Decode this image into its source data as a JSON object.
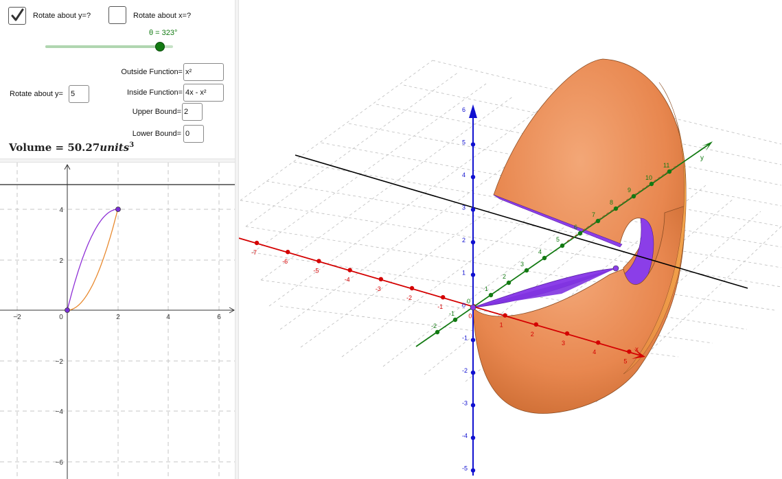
{
  "controls": {
    "rotate_y_checkbox": {
      "label": "Rotate about y=?",
      "checked": true
    },
    "rotate_x_checkbox": {
      "label": "Rotate about x=?",
      "checked": false
    },
    "theta_slider": {
      "label": "θ = 323°",
      "value_deg": 323,
      "max_deg": 360
    },
    "outside_function": {
      "label": "Outside Function=",
      "value": "x²"
    },
    "inside_function": {
      "label": "Inside Function=",
      "value": "4x - x²"
    },
    "upper_bound": {
      "label": "Upper Bound=",
      "value": "2"
    },
    "lower_bound": {
      "label": "Lower Bound=",
      "value": "0"
    },
    "rotate_about_y": {
      "label": "Rotate about y=",
      "value": "5"
    },
    "volume": {
      "prefix": "Volume = ",
      "value": "50.27",
      "unit": "units",
      "exponent": "3"
    }
  },
  "graph2d": {
    "x_ticks": [
      "−2",
      "0",
      "2",
      "4",
      "6"
    ],
    "y_ticks": [
      "4",
      "2",
      "−2",
      "−4",
      "−6"
    ],
    "colors": {
      "outside": "#e8892e",
      "inside": "#8e2fd6",
      "point": "#7a2fd6"
    }
  },
  "view3d": {
    "x_axis_labels": [
      "-7",
      "-6",
      "-5",
      "-4",
      "-3",
      "-2",
      "-1",
      "0",
      "1",
      "2",
      "3",
      "4",
      "5"
    ],
    "x_axis_name": "x",
    "y_axis_labels": [
      "-2",
      "-1",
      "0",
      "1",
      "2",
      "3",
      "4",
      "5",
      "6",
      "7",
      "8",
      "9",
      "10",
      "11"
    ],
    "y_axis_name": "y",
    "z_axis_labels": [
      "6",
      "5",
      "4",
      "3",
      "2",
      "1",
      "0",
      "-1",
      "-2",
      "-3",
      "-4",
      "-5"
    ],
    "colors": {
      "x_axis": "#d40000",
      "y_axis": "#127a12",
      "z_axis": "#1010d0",
      "solid": "#ec8e55",
      "cut_face": "#8b3ee8",
      "rotation_line": "#000000"
    }
  }
}
